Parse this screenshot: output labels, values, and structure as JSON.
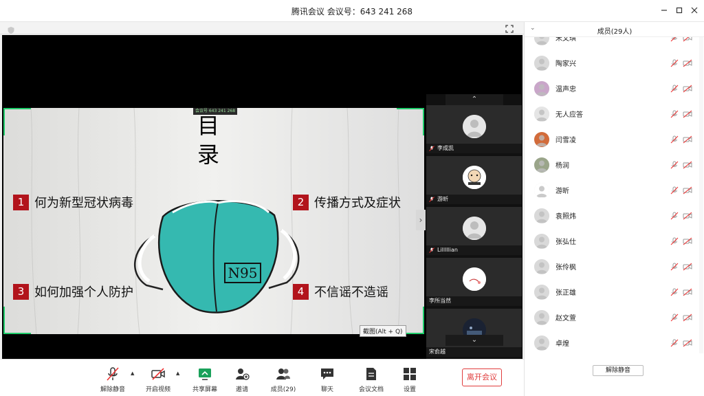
{
  "window": {
    "title": "腾讯会议  会议号：643 241 268"
  },
  "slide": {
    "title_char1": "目",
    "title_char2": "录",
    "meeting_tag": "会议号 643 241 268",
    "items": [
      {
        "num": "1",
        "text": "何为新型冠状病毒"
      },
      {
        "num": "2",
        "text": "传播方式及症状"
      },
      {
        "num": "3",
        "text": "如何加强个人防护"
      },
      {
        "num": "4",
        "text": "不信谣不造谣"
      }
    ],
    "mask_label": "N95",
    "screenshot_hint": "截图(Alt + Q)",
    "accent_color": "#b2141c",
    "mask_color": "#35b9b0"
  },
  "tiles": [
    {
      "name": "李成凯"
    },
    {
      "name": "游昕"
    },
    {
      "name": "Lilllllian"
    },
    {
      "name": "李所当然"
    },
    {
      "name": "宋俞越"
    }
  ],
  "toolbar": {
    "unmute": "解除静音",
    "video": "开启视频",
    "share": "共享屏幕",
    "invite": "邀请",
    "members": "成员(29)",
    "chat": "聊天",
    "docs": "会议文档",
    "settings": "设置",
    "leave": "离开会议"
  },
  "panel": {
    "title": "成员(29人)",
    "members": [
      {
        "name": "宋文琪"
      },
      {
        "name": "陶家兴"
      },
      {
        "name": "温声忠"
      },
      {
        "name": "无人应答"
      },
      {
        "name": "闫雪凌"
      },
      {
        "name": "杨润"
      },
      {
        "name": "游昕"
      },
      {
        "name": "袁照炜"
      },
      {
        "name": "张弘仕"
      },
      {
        "name": "张伶枫"
      },
      {
        "name": "张正雄"
      },
      {
        "name": "赵文萱"
      },
      {
        "name": "卓煌"
      }
    ],
    "unmute_all": "解除静音"
  }
}
